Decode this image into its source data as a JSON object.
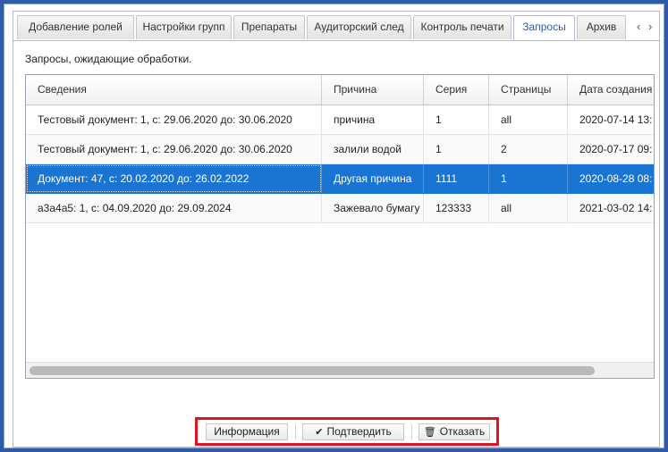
{
  "tabs": [
    {
      "label": "Добавление ролей",
      "active": false
    },
    {
      "label": "Настройки групп",
      "active": false
    },
    {
      "label": "Препараты",
      "active": false
    },
    {
      "label": "Аудиторский след",
      "active": false
    },
    {
      "label": "Контроль печати",
      "active": false
    },
    {
      "label": "Запросы",
      "active": true
    },
    {
      "label": "Архив",
      "active": false
    }
  ],
  "tab_scroll": {
    "left": "‹",
    "right": "›"
  },
  "description": "Запросы, ожидающие обработки.",
  "grid": {
    "columns": [
      "Сведения",
      "Причина",
      "Серия",
      "Страницы",
      "Дата создания"
    ],
    "rows": [
      {
        "details": "Тестовый документ: 1, с: 29.06.2020 до: 30.06.2020",
        "reason": "причина",
        "series": "1",
        "pages": "all",
        "created": "2020-07-14 13:",
        "selected": false
      },
      {
        "details": "Тестовый документ: 1, с: 29.06.2020 до: 30.06.2020",
        "reason": "залили водой",
        "series": "1",
        "pages": "2",
        "created": "2020-07-17 09:",
        "selected": false
      },
      {
        "details": "Документ: 47, с: 20.02.2020 до: 26.02.2022",
        "reason": "Другая причина",
        "series": "1111",
        "pages": "1",
        "created": "2020-08-28 08:",
        "selected": true
      },
      {
        "details": "а3а4а5: 1, с: 04.09.2020 до: 29.09.2024",
        "reason": "Зажевало бумагу",
        "series": "123333",
        "pages": "all",
        "created": "2021-03-02 14:",
        "selected": false
      }
    ]
  },
  "toolbar": {
    "info_label": "Информация",
    "confirm_label": "Подтвердить",
    "reject_label": "Отказать",
    "confirm_icon": "check-icon",
    "reject_icon": "trash-icon"
  },
  "colors": {
    "selected_row": "#1a74d1",
    "active_tab_text": "#1f5fbf",
    "highlight_border": "#e0141e",
    "frame_border": "#2f5aa8"
  }
}
